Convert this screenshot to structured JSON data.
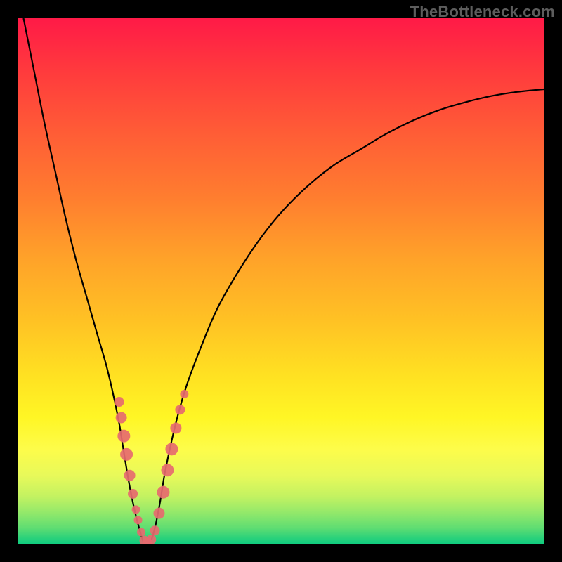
{
  "watermark": {
    "text": "TheBottleneck.com"
  },
  "colors": {
    "frame": "#000000",
    "curve": "#000000",
    "marker": "#e66a6f",
    "gradient_stops": [
      "#ff1a47",
      "#ff7d2f",
      "#ffe122",
      "#10cc7f"
    ]
  },
  "chart_data": {
    "type": "line",
    "title": "",
    "xlabel": "",
    "ylabel": "",
    "xlim": [
      0,
      100
    ],
    "ylim": [
      0,
      100
    ],
    "series": [
      {
        "name": "bottleneck-curve",
        "x": [
          1,
          3,
          5,
          7,
          9,
          11,
          13,
          15,
          17,
          19,
          20,
          21,
          22,
          23,
          24,
          25,
          26,
          27,
          28,
          30,
          32,
          35,
          38,
          42,
          46,
          50,
          55,
          60,
          65,
          70,
          75,
          80,
          85,
          90,
          95,
          100
        ],
        "values": [
          100,
          90,
          80,
          71,
          62,
          54,
          47,
          40,
          33,
          24,
          18,
          12,
          7,
          3,
          0,
          0,
          3,
          8,
          14,
          23,
          30,
          38,
          45,
          52,
          58,
          63,
          68,
          72,
          75,
          78,
          80.5,
          82.5,
          84,
          85.2,
          86,
          86.5
        ]
      }
    ],
    "markers": [
      {
        "x": 19.2,
        "y": 27,
        "size": 7
      },
      {
        "x": 19.6,
        "y": 24,
        "size": 8
      },
      {
        "x": 20.1,
        "y": 20.5,
        "size": 9
      },
      {
        "x": 20.6,
        "y": 17,
        "size": 9
      },
      {
        "x": 21.2,
        "y": 13,
        "size": 8
      },
      {
        "x": 21.8,
        "y": 9.5,
        "size": 7
      },
      {
        "x": 22.4,
        "y": 6.5,
        "size": 6
      },
      {
        "x": 22.8,
        "y": 4.5,
        "size": 6
      },
      {
        "x": 23.4,
        "y": 2.2,
        "size": 6
      },
      {
        "x": 24.0,
        "y": 0.6,
        "size": 7
      },
      {
        "x": 24.6,
        "y": 0.2,
        "size": 7
      },
      {
        "x": 25.3,
        "y": 0.8,
        "size": 7
      },
      {
        "x": 26.0,
        "y": 2.5,
        "size": 7
      },
      {
        "x": 26.8,
        "y": 5.8,
        "size": 8
      },
      {
        "x": 27.6,
        "y": 9.8,
        "size": 9
      },
      {
        "x": 28.4,
        "y": 14,
        "size": 9
      },
      {
        "x": 29.2,
        "y": 18,
        "size": 9
      },
      {
        "x": 30.0,
        "y": 22,
        "size": 8
      },
      {
        "x": 30.8,
        "y": 25.5,
        "size": 7
      },
      {
        "x": 31.6,
        "y": 28.5,
        "size": 6
      }
    ],
    "curve_minimum": {
      "x": 24.5,
      "y": 0
    }
  }
}
